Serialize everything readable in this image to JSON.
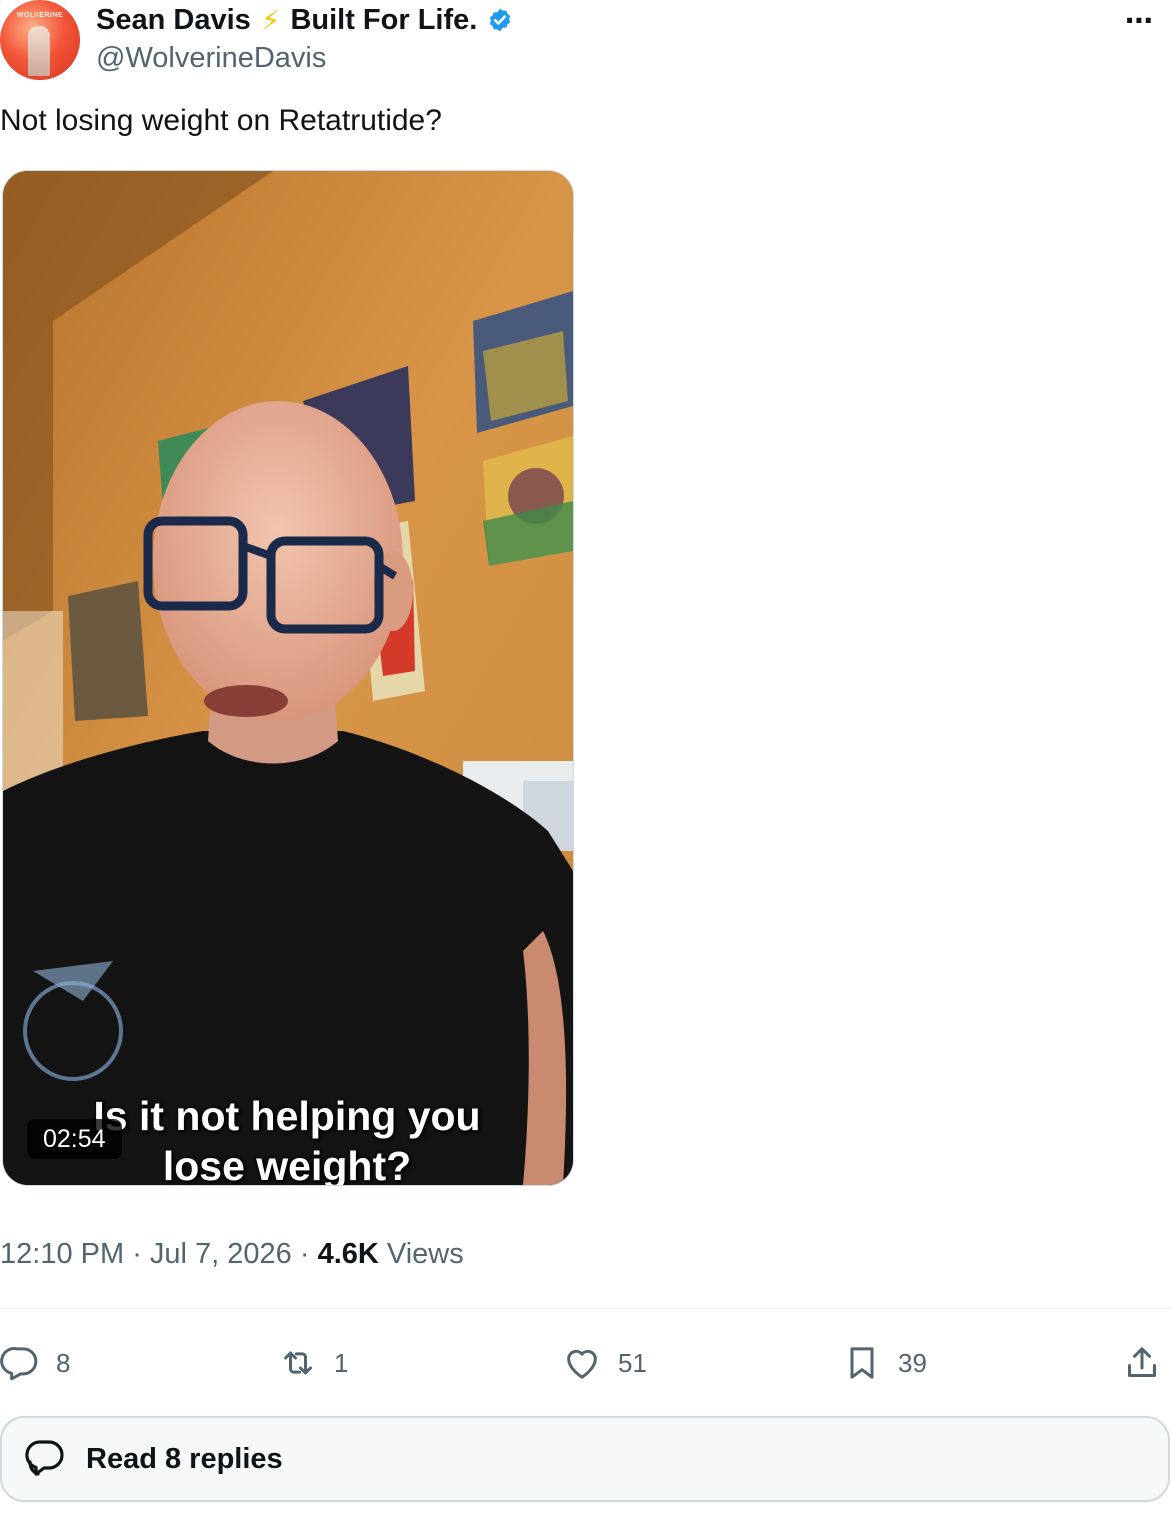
{
  "author": {
    "display_name": "Sean Davis",
    "name_emoji": "⚡",
    "name_suffix": "Built For Life.",
    "handle": "@WolverineDavis",
    "verified": true,
    "avatar_text": "WOLVERINE"
  },
  "menu_icon": "⋯",
  "tweet": {
    "text": "Not losing weight on Retatrutide?"
  },
  "video": {
    "caption_line1": "Is it not helping you",
    "caption_line2": "lose weight?",
    "duration": "02:54"
  },
  "meta": {
    "time": "12:10 PM",
    "date": "Jul 7, 2026",
    "views_count": "4.6K",
    "views_label": "Views"
  },
  "actions": {
    "replies": "8",
    "reposts": "1",
    "likes": "51",
    "bookmarks": "39"
  },
  "read_replies_label": "Read 8 replies",
  "colors": {
    "verified_blue": "#1d9bf0",
    "muted_text": "#536471",
    "bolt": "#f5c518"
  }
}
